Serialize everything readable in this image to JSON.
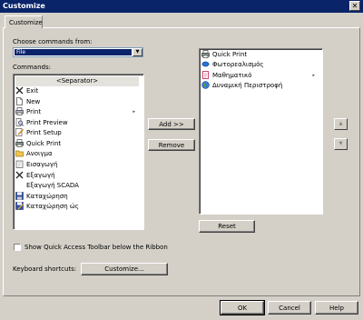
{
  "window": {
    "title": "Customize",
    "close_glyph": "✕"
  },
  "tab": {
    "label": "Customize"
  },
  "choose": {
    "label": "Choose commands from:",
    "value": "File",
    "arrow_glyph": "▼"
  },
  "commands": {
    "label": "Commands:",
    "items": [
      {
        "label": "<Separator>",
        "icon": "none"
      },
      {
        "label": "Exit",
        "icon": "x-icon"
      },
      {
        "label": "New",
        "icon": "new-doc-icon"
      },
      {
        "label": "Print",
        "icon": "printer-icon",
        "submenu": "▸"
      },
      {
        "label": "Print Preview",
        "icon": "print-preview-icon"
      },
      {
        "label": "Print Setup",
        "icon": "print-setup-icon"
      },
      {
        "label": "Quick Print",
        "icon": "quick-print-icon"
      },
      {
        "label": "Ανοιγμα",
        "icon": "open-folder-icon"
      },
      {
        "label": "Εισαγωγή",
        "icon": "import-icon"
      },
      {
        "label": "Εξαγωγή",
        "icon": "x-icon"
      },
      {
        "label": "Εξαγωγή SCADA",
        "icon": "none"
      },
      {
        "label": "Καταχώρηση",
        "icon": "save-icon"
      },
      {
        "label": "Καταχώρηση ώς",
        "icon": "save-as-icon"
      }
    ]
  },
  "buttons": {
    "add": "Add >>",
    "remove": "Remove",
    "reset": "Reset",
    "customize": "Customize...",
    "ok": "OK",
    "cancel": "Cancel",
    "help": "Help"
  },
  "toolbar_list": {
    "items": [
      {
        "label": "Quick Print",
        "icon": "quick-print-icon"
      },
      {
        "label": "Φωτορεαλισμός",
        "icon": "blue-blob-icon"
      },
      {
        "label": "Μαθηματικό",
        "icon": "math-icon",
        "submenu": "▸"
      },
      {
        "label": "Δυναμική Περιστροφή",
        "icon": "globe-icon"
      }
    ]
  },
  "move": {
    "up_glyph": "▲",
    "down_glyph": "▼"
  },
  "options": {
    "show_below_label": "Show Quick Access Toolbar below the Ribbon",
    "show_below_checked": false
  },
  "keyboard": {
    "label": "Keyboard shortcuts:"
  }
}
